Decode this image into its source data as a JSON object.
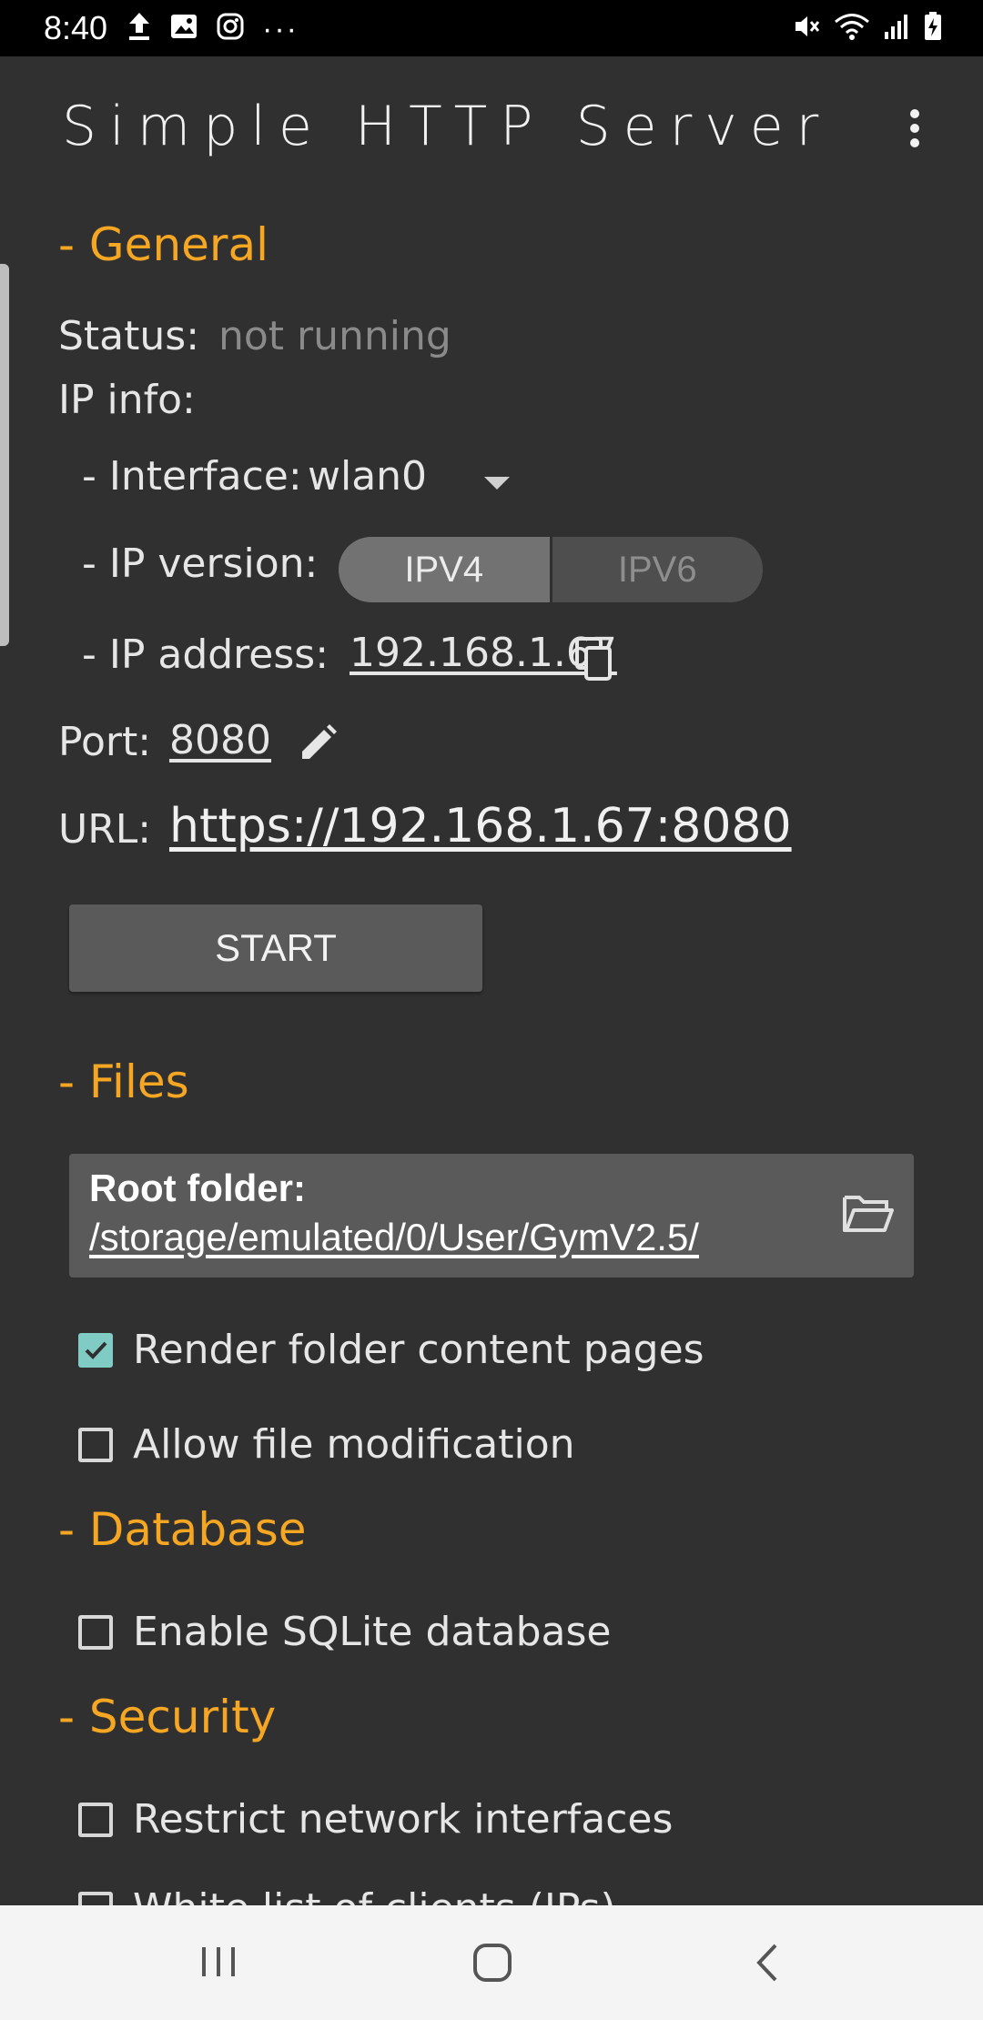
{
  "status_bar": {
    "time": "8:40",
    "left_icons": [
      "upload-icon",
      "image-icon",
      "instagram-icon"
    ],
    "more": "···",
    "right_icons": [
      "mute-icon",
      "wifi-icon",
      "signal-icon",
      "battery-charging-icon"
    ]
  },
  "app": {
    "title": "Simple HTTP Server",
    "menu_icon": "more-vertical-icon"
  },
  "general": {
    "heading": "- General",
    "status_label": "Status:",
    "status_value": "not running",
    "ip_info_label": "IP info:",
    "interface_label": "- Interface:",
    "interface_value": "wlan0",
    "ip_version_label": "- IP version:",
    "ip_version_options": [
      "IPV4",
      "IPV6"
    ],
    "ip_version_selected": "IPV4",
    "ip_address_label": "- IP address:",
    "ip_address_value": "192.168.1.67",
    "port_label": "Port:",
    "port_value": "8080",
    "url_label": "URL:",
    "url_value": "https://192.168.1.67:8080",
    "start_button": "START"
  },
  "files": {
    "heading": "- Files",
    "root_folder_label": "Root folder:",
    "root_folder_path": "/storage/emulated/0/User/GymV2.5/",
    "options": [
      {
        "label": "Render folder content pages",
        "checked": true
      },
      {
        "label": "Allow file modification",
        "checked": false
      }
    ]
  },
  "database": {
    "heading": "- Database",
    "options": [
      {
        "label": "Enable SQLite database",
        "checked": false
      }
    ]
  },
  "security": {
    "heading": "- Security",
    "options": [
      {
        "label": "Restrict network interfaces",
        "checked": false
      },
      {
        "label": "White list of clients (IPs)",
        "checked": false
      }
    ]
  },
  "colors": {
    "background": "#303030",
    "accent": "#f5a623",
    "checkbox_checked": "#80cbc4",
    "button": "#5a5a5a"
  },
  "nav_bar": {
    "buttons": [
      "recent-apps-icon",
      "home-icon",
      "back-icon"
    ]
  }
}
